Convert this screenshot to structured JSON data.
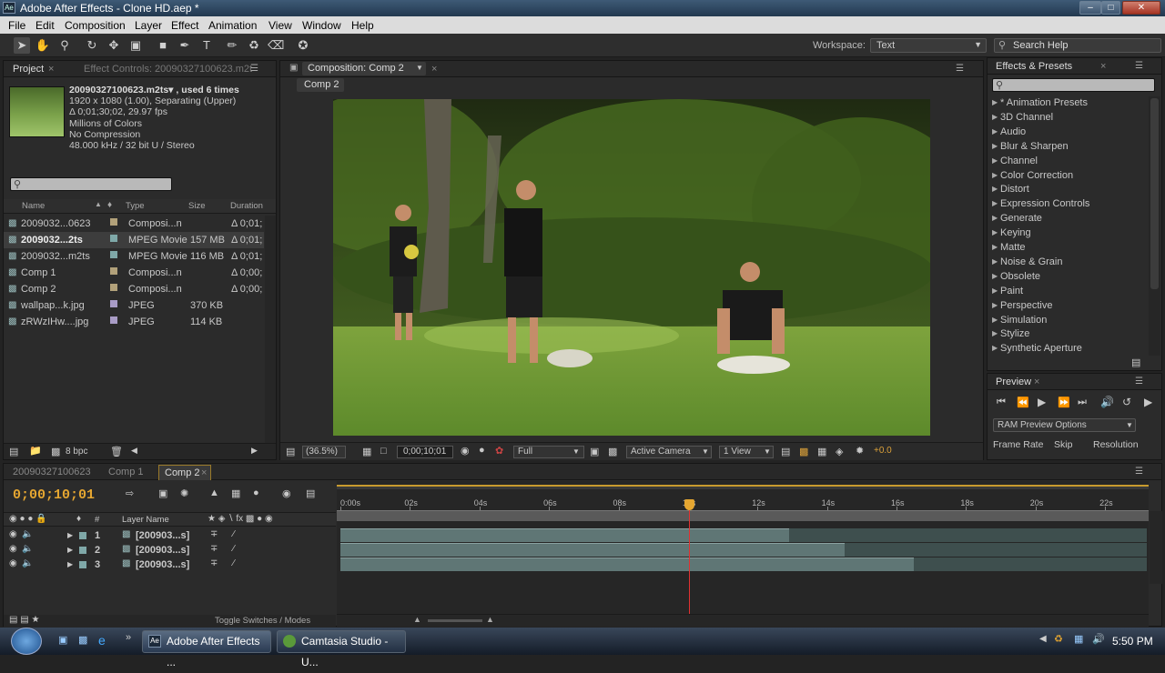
{
  "window": {
    "title": "Adobe After Effects - Clone HD.aep *",
    "app_badge": "Ae"
  },
  "menu": [
    "File",
    "Edit",
    "Composition",
    "Layer",
    "Effect",
    "Animation",
    "View",
    "Window",
    "Help"
  ],
  "toolbar": {
    "workspace_label": "Workspace:",
    "workspace_value": "Text",
    "search_help": "Search Help"
  },
  "project": {
    "tab": "Project",
    "effect_controls_tab": "Effect Controls: 20090327100623.m2t",
    "footage_info": [
      "20090327100623.m2ts▾ , used 6 times",
      "1920 x 1080 (1.00), Separating (Upper)",
      "Δ 0;01;30;02, 29.97 fps",
      "Millions of Colors",
      "No Compression",
      "48.000 kHz / 32 bit U / Stereo"
    ],
    "columns": {
      "name": "Name",
      "type": "Type",
      "size": "Size",
      "duration": "Duration"
    },
    "items": [
      {
        "name": "2009032...0623",
        "type": "Composi...n",
        "size": "",
        "duration": "Δ 0;01;",
        "color": "#b2a17a",
        "selected": false
      },
      {
        "name": "2009032...2ts",
        "type": "MPEG Movie",
        "size": "157 MB",
        "duration": "Δ 0;01;",
        "color": "#7fa8a8",
        "selected": true
      },
      {
        "name": "2009032...m2ts",
        "type": "MPEG Movie",
        "size": "116 MB",
        "duration": "Δ 0;01;",
        "color": "#7fa8a8",
        "selected": false
      },
      {
        "name": "Comp 1",
        "type": "Composi...n",
        "size": "",
        "duration": "Δ 0;00;",
        "color": "#b2a17a",
        "selected": false
      },
      {
        "name": "Comp 2",
        "type": "Composi...n",
        "size": "",
        "duration": "Δ 0;00;",
        "color": "#b2a17a",
        "selected": false
      },
      {
        "name": "wallpap...k.jpg",
        "type": "JPEG",
        "size": "370 KB",
        "duration": "",
        "color": "#a99cc6",
        "selected": false
      },
      {
        "name": "zRWzIHw....jpg",
        "type": "JPEG",
        "size": "114 KB",
        "duration": "",
        "color": "#a99cc6",
        "selected": false
      }
    ],
    "bpc": "8 bpc"
  },
  "composition": {
    "tab": "Composition: Comp 2",
    "subtab": "Comp 2",
    "zoom": "(36.5%)",
    "timecode": "0;00;10;01",
    "resolution": "Full",
    "camera": "Active Camera",
    "view": "1 View",
    "exposure": "+0.0"
  },
  "effects": {
    "tab": "Effects & Presets",
    "items": [
      "* Animation Presets",
      "3D Channel",
      "Audio",
      "Blur & Sharpen",
      "Channel",
      "Color Correction",
      "Distort",
      "Expression Controls",
      "Generate",
      "Keying",
      "Matte",
      "Noise & Grain",
      "Obsolete",
      "Paint",
      "Perspective",
      "Simulation",
      "Stylize",
      "Synthetic Aperture"
    ]
  },
  "preview": {
    "tab": "Preview",
    "ram_options": "RAM Preview Options",
    "frame_rate": "Frame Rate",
    "skip": "Skip",
    "resolution": "Resolution"
  },
  "timeline": {
    "tabs": [
      "20090327100623",
      "Comp 1",
      "Comp 2"
    ],
    "timecode": "0;00;10;01",
    "layer_name_header": "Layer Name",
    "num_header": "#",
    "ticks": [
      "0:00s",
      "02s",
      "04s",
      "06s",
      "08s",
      "10s",
      "12s",
      "14s",
      "16s",
      "18s",
      "20s",
      "22s"
    ],
    "layers": [
      {
        "index": "1",
        "name": "[200903...s]",
        "bar_end_seconds": 12.9
      },
      {
        "index": "2",
        "name": "[200903...s]",
        "bar_end_seconds": 14.5
      },
      {
        "index": "3",
        "name": "[200903...s]",
        "bar_end_seconds": 16.5
      }
    ],
    "duration_seconds": 23.2,
    "playhead_seconds": 10.03,
    "toggle_label": "Toggle Switches / Modes"
  },
  "taskbar": {
    "tasks": [
      "Adobe After Effects ...",
      "Camtasia Studio - U..."
    ],
    "clock": "5:50 PM"
  }
}
